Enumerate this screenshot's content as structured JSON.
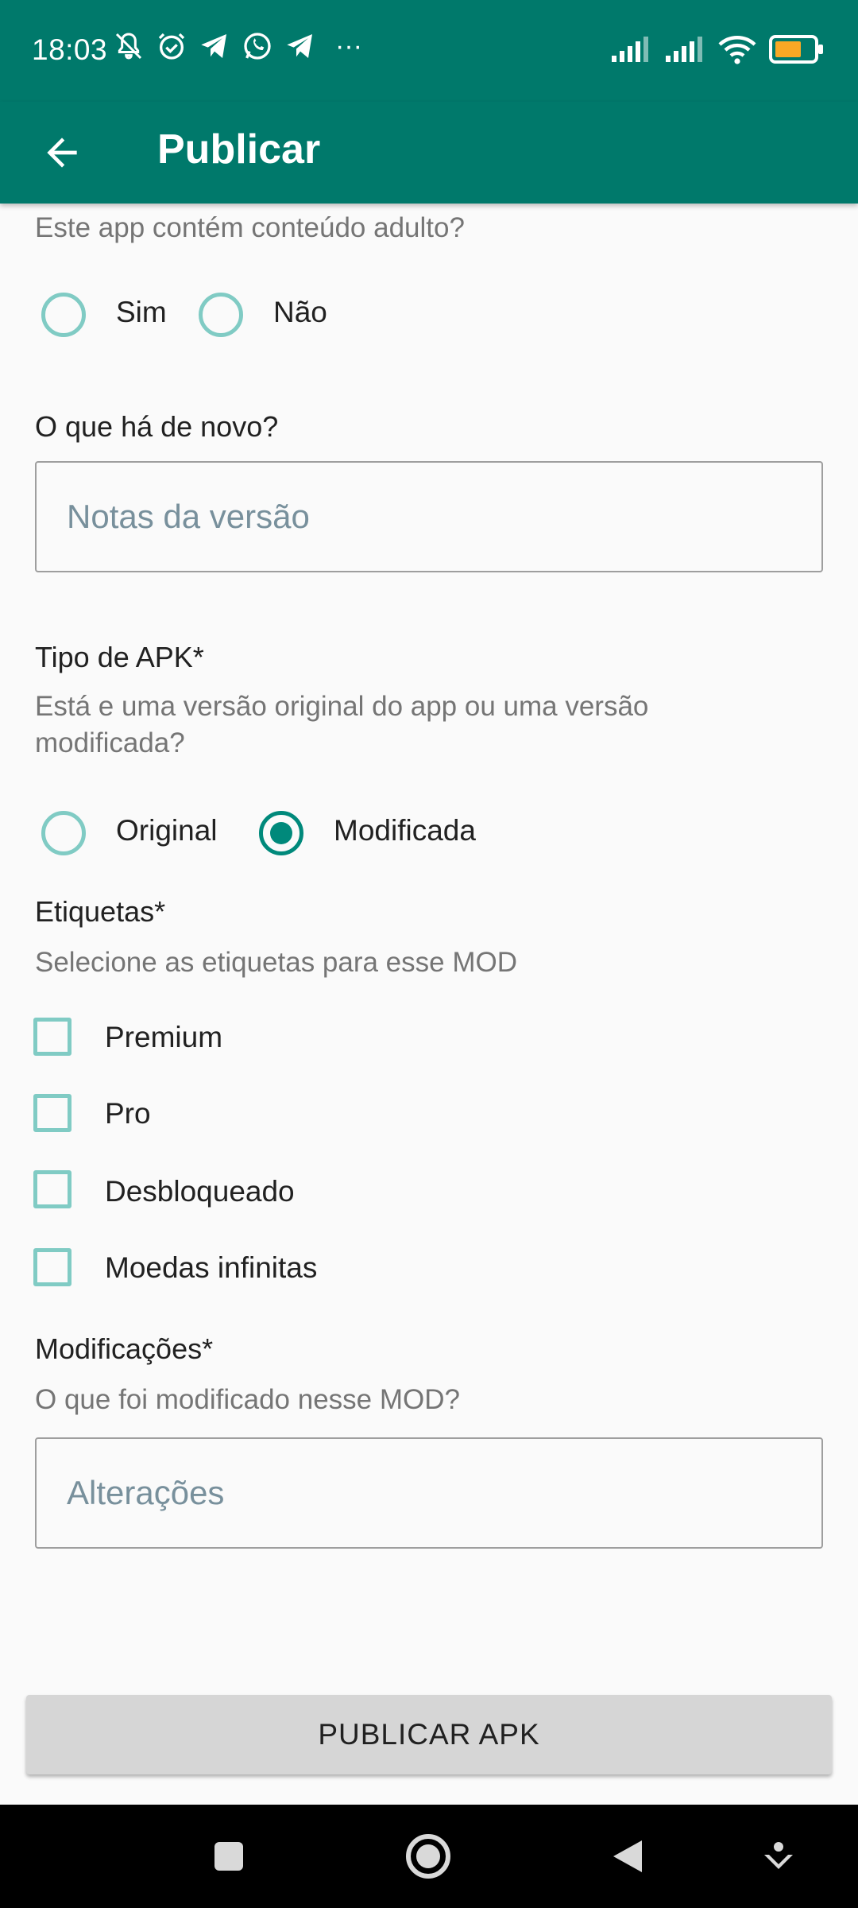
{
  "status_bar": {
    "time": "18:03",
    "icons": [
      "muted-bell-icon",
      "alarm-icon",
      "telegram-icon",
      "whatsapp-icon",
      "telegram-icon",
      "more-dots-icon",
      "signal-icon",
      "signal-icon",
      "wifi-icon",
      "battery-icon"
    ],
    "more": "···"
  },
  "app_bar": {
    "title": "Publicar",
    "back_icon": "arrow-left-icon"
  },
  "adult_content": {
    "question": "Este app contém conteúdo adulto?",
    "options": [
      "Sim",
      "Não"
    ],
    "selected": null
  },
  "whats_new": {
    "label": "O que há de novo?",
    "placeholder": "Notas da versão",
    "value": ""
  },
  "apk_type": {
    "label": "Tipo de APK*",
    "description": "Está e uma versão original do app ou uma versão modificada?",
    "options": [
      "Original",
      "Modificada"
    ],
    "selected": "Modificada"
  },
  "tags": {
    "label": "Etiquetas*",
    "description": "Selecione as etiquetas para esse MOD",
    "items": [
      {
        "label": "Premium",
        "checked": false
      },
      {
        "label": "Pro",
        "checked": false
      },
      {
        "label": "Desbloqueado",
        "checked": false
      },
      {
        "label": "Moedas infinitas",
        "checked": false
      }
    ]
  },
  "modifications": {
    "label": "Modificações*",
    "description": "O que foi modificado nesse MOD?",
    "placeholder": "Alterações",
    "value": ""
  },
  "publish_button": "PUBLICAR APK",
  "colors": {
    "primary": "#00796B",
    "accent": "#00897B",
    "control_unchecked": "#80CBC4",
    "button_bg": "#D6D6D6"
  },
  "nav_bar": {
    "icons": [
      "recents-square-icon",
      "home-circle-icon",
      "back-triangle-icon",
      "assistant-down-icon"
    ]
  }
}
